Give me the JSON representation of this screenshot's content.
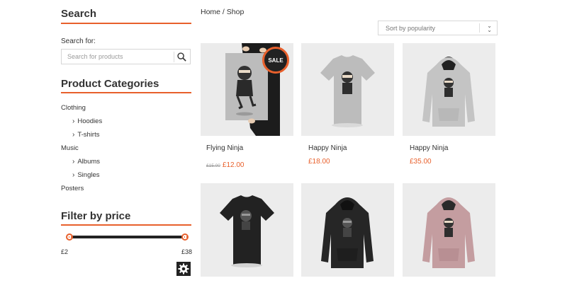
{
  "sidebar": {
    "search": {
      "title": "Search",
      "label": "Search for:",
      "placeholder": "Search for products"
    },
    "categories": {
      "title": "Product Categories",
      "items": [
        {
          "label": "Clothing",
          "level": 0
        },
        {
          "label": "Hoodies",
          "level": 1
        },
        {
          "label": "T-shirts",
          "level": 1
        },
        {
          "label": "Music",
          "level": 0
        },
        {
          "label": "Albums",
          "level": 1
        },
        {
          "label": "Singles",
          "level": 1
        },
        {
          "label": "Posters",
          "level": 0
        }
      ]
    },
    "price_filter": {
      "title": "Filter by price",
      "min_label": "£2",
      "max_label": "£38",
      "min_fraction": 0.0,
      "max_fraction": 1.0
    }
  },
  "main": {
    "breadcrumb": "Home / Shop",
    "sort": {
      "selected": "Sort by popularity"
    },
    "products": [
      {
        "name": "Flying Ninja",
        "old_price": "£15.00",
        "price": "£12.00",
        "sale": "SALE",
        "kind": "poster"
      },
      {
        "name": "Happy Ninja",
        "price": "£18.00",
        "kind": "tshirt",
        "color": "#bcbcbc"
      },
      {
        "name": "Happy Ninja",
        "price": "£35.00",
        "kind": "hoodie",
        "color": "#c4c4c4"
      },
      {
        "kind": "tshirt",
        "color": "#222222"
      },
      {
        "kind": "hoodie",
        "color": "#262626"
      },
      {
        "kind": "hoodie",
        "color": "#c49da0"
      }
    ]
  },
  "colors": {
    "accent": "#e8602c",
    "dark": "#222222"
  }
}
